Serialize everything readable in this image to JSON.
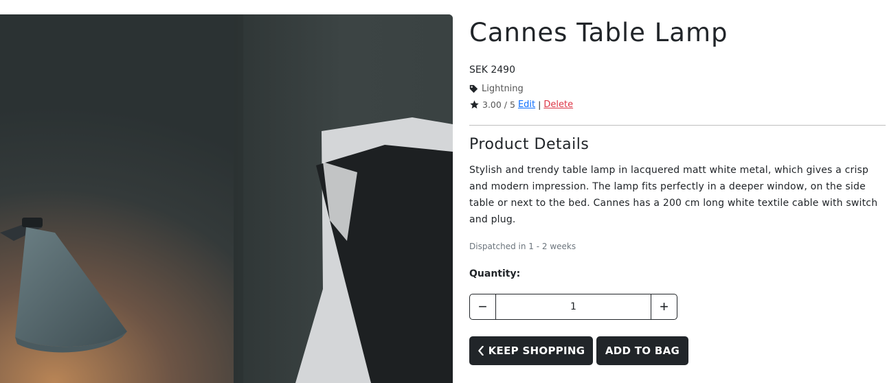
{
  "product": {
    "name": "Cannes Table Lamp",
    "price": "SEK 2490",
    "category": "Lightning",
    "rating": "3.00 / 5",
    "edit_label": "Edit",
    "separator": "|",
    "delete_label": "Delete"
  },
  "details": {
    "heading": "Product Details",
    "description": "Stylish and trendy table lamp in lacquered matt white metal, which gives a crisp and modern impression. The lamp fits perfectly in a deeper window, on the side table or next to the bed. Cannes has a 200 cm long white textile cable with switch and plug.",
    "dispatch": "Dispatched in 1 - 2 weeks"
  },
  "quantity": {
    "label": "Quantity:",
    "value": "1",
    "decrement_symbol": "−",
    "increment_symbol": "+"
  },
  "actions": {
    "keep_shopping": "KEEP SHOPPING",
    "add_to_bag": "ADD TO BAG"
  },
  "icons": {
    "category": "tag-icon",
    "rating": "star-icon",
    "back": "chevron-left-icon"
  },
  "colors": {
    "dark": "#212529",
    "link": "#0d6efd",
    "danger": "#dc3545",
    "muted": "#6c757d"
  }
}
